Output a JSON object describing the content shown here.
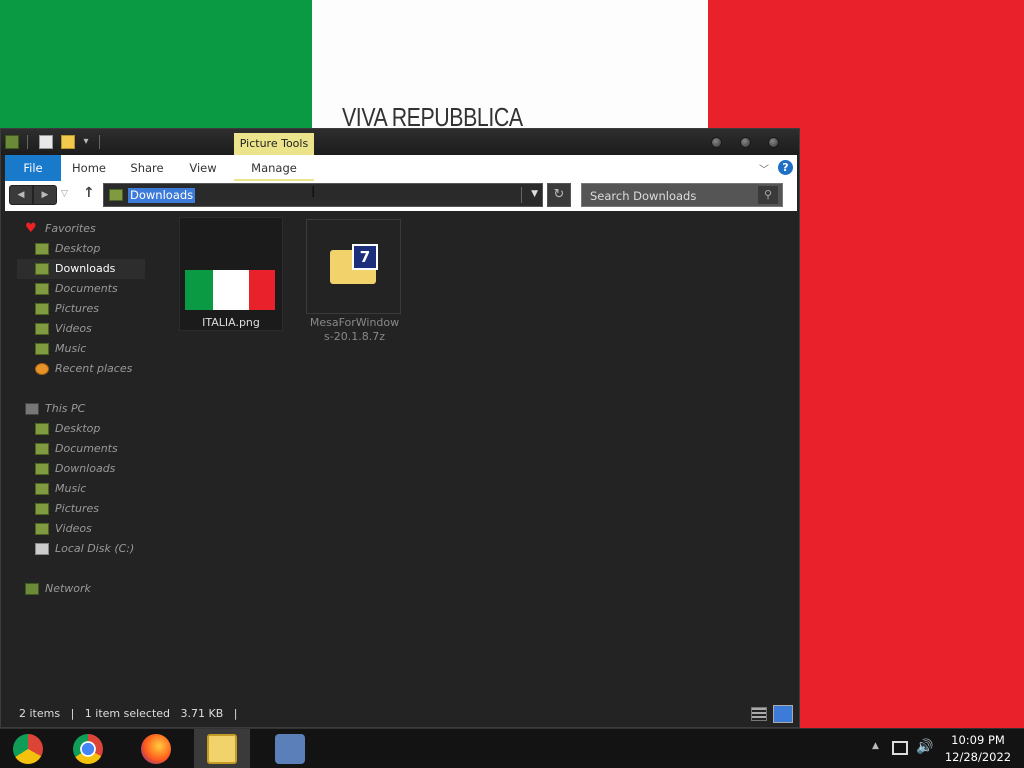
{
  "wallpaper": {
    "text": "VIVA REPUBBLICA",
    "colors": {
      "green": "#0a9a44",
      "white": "#fdfdfd",
      "red": "#e8212b"
    }
  },
  "window": {
    "contextual_tab": "Picture Tools",
    "ribbon": {
      "tabs": [
        "File",
        "Home",
        "Share",
        "View",
        "Manage"
      ],
      "help": "?"
    },
    "address": {
      "value": "Downloads"
    },
    "search": {
      "placeholder": "Search Downloads"
    },
    "sidebar": {
      "favorites": {
        "label": "Favorites",
        "items": [
          "Desktop",
          "Downloads",
          "Documents",
          "Pictures",
          "Videos",
          "Music",
          "Recent places"
        ]
      },
      "this_pc": {
        "label": "This PC",
        "items": [
          "Desktop",
          "Documents",
          "Downloads",
          "Music",
          "Pictures",
          "Videos",
          "Local Disk (C:)"
        ]
      },
      "network": {
        "label": "Network"
      },
      "selected": "Downloads"
    },
    "files": [
      {
        "name": "ITALIA.png",
        "selected": true
      },
      {
        "name": "MesaForWindows-20.1.8.7z",
        "name_line1": "MesaForWindow",
        "name_line2": "s-20.1.8.7z",
        "badge": "7"
      }
    ],
    "status": {
      "count": "2 items",
      "selection": "1 item selected",
      "size": "3.71 KB"
    }
  },
  "taskbar": {
    "apps": [
      "chrome-canary",
      "chrome",
      "firefox",
      "file-explorer",
      "network-people"
    ],
    "active": "file-explorer",
    "clock": {
      "time": "10:09 PM",
      "date": "12/28/2022"
    }
  },
  "accent": "#1979ca"
}
